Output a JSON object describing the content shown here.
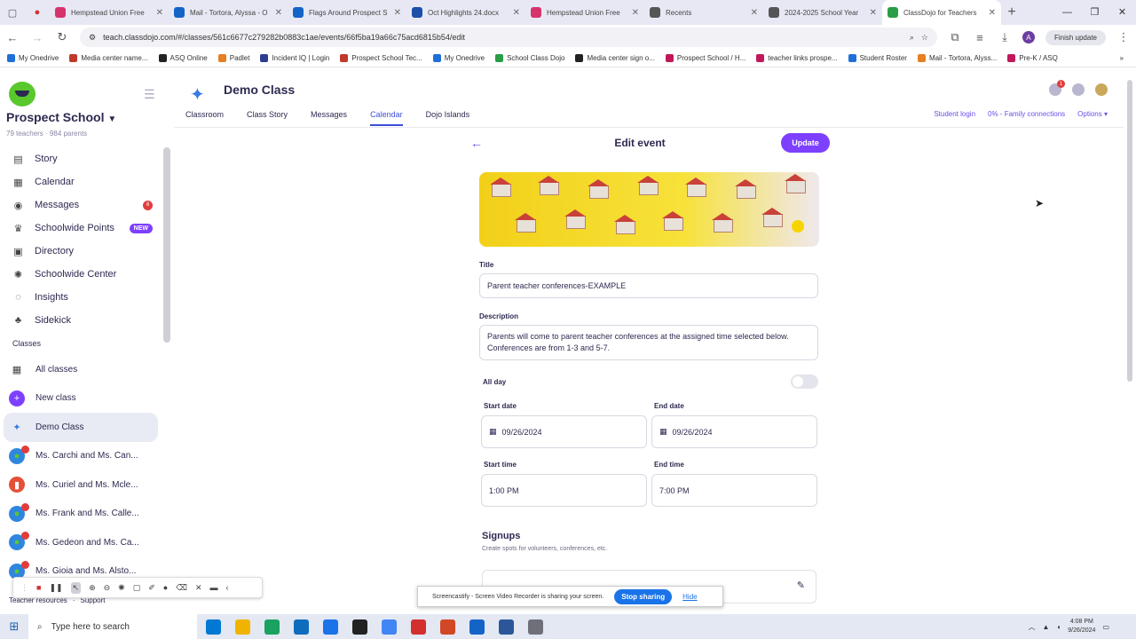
{
  "browser": {
    "tabs": [
      {
        "label": "Hempstead Union Free",
        "color": "#d6336c",
        "active": false
      },
      {
        "label": "Mail - Tortora, Alyssa - O",
        "color": "#1464c8",
        "active": false
      },
      {
        "label": "Flags Around Prospect S",
        "color": "#1464c8",
        "active": false
      },
      {
        "label": "Oct Highlights 24.docx",
        "color": "#1b4fa8",
        "active": false
      },
      {
        "label": "Hempstead Union Free",
        "color": "#d6336c",
        "active": false
      },
      {
        "label": "Recents",
        "color": "#555555",
        "active": false
      },
      {
        "label": "2024-2025 School Year",
        "color": "#555555",
        "active": false
      },
      {
        "label": "ClassDojo for Teachers",
        "color": "#2a9d46",
        "active": true
      }
    ],
    "url": "teach.classdojo.com/#/classes/561c6677c279282b0883c1ae/events/66f5ba19a66c75acd6815b54/edit",
    "finish_update": "Finish update",
    "profile_initial": "A",
    "bookmarks": [
      {
        "label": "My Onedrive",
        "color": "#1e6fd9"
      },
      {
        "label": "Media center name...",
        "color": "#c0392b"
      },
      {
        "label": "ASQ Online",
        "color": "#222222"
      },
      {
        "label": "Padlet",
        "color": "#e67e22"
      },
      {
        "label": "Incident IQ | Login",
        "color": "#2c3e90"
      },
      {
        "label": "Prospect School Tec...",
        "color": "#c0392b"
      },
      {
        "label": "My Onedrive",
        "color": "#1e6fd9"
      },
      {
        "label": "School Class Dojo",
        "color": "#2a9d46"
      },
      {
        "label": "Media center sign o...",
        "color": "#222222"
      },
      {
        "label": "Prospect School / H...",
        "color": "#c2185b"
      },
      {
        "label": "teacher links prospe...",
        "color": "#c2185b"
      },
      {
        "label": "Student Roster",
        "color": "#1e6fd9"
      },
      {
        "label": "Mail - Tortora, Alyss...",
        "color": "#e67e22"
      },
      {
        "label": "Pre-K / ASQ",
        "color": "#c2185b"
      }
    ]
  },
  "sidebar": {
    "school_name": "Prospect School",
    "school_sub": "79 teachers · 984 parents",
    "nav": [
      {
        "label": "Story",
        "icon": "story-icon",
        "glyph": "▤"
      },
      {
        "label": "Calendar",
        "icon": "calendar-icon",
        "glyph": "▦"
      },
      {
        "label": "Messages",
        "icon": "messages-icon",
        "glyph": "◉",
        "badge": "8"
      },
      {
        "label": "Schoolwide Points",
        "icon": "trophy-icon",
        "glyph": "♛",
        "new": "NEW"
      },
      {
        "label": "Directory",
        "icon": "directory-icon",
        "glyph": "▣"
      },
      {
        "label": "Schoolwide Center",
        "icon": "center-icon",
        "glyph": "✺"
      },
      {
        "label": "Insights",
        "icon": "insights-icon",
        "glyph": "◌"
      },
      {
        "label": "Sidekick",
        "icon": "sidekick-icon",
        "glyph": "♣"
      }
    ],
    "classes_heading": "Classes",
    "classes": [
      {
        "label": "All classes",
        "glyph": "▦",
        "color": "#ffffff",
        "fg": "#444444",
        "dot": false
      },
      {
        "label": "New class",
        "glyph": "+",
        "color": "#7d40ff",
        "fg": "#ffffff",
        "dot": false
      },
      {
        "label": "Demo Class",
        "glyph": "✦",
        "color": "#e8eaf4",
        "fg": "#3b7be3",
        "dot": false,
        "selected": true
      },
      {
        "label": "Ms. Carchi and Ms. Can...",
        "glyph": "●",
        "color": "#2e86de",
        "fg": "#58c82c",
        "dot": true
      },
      {
        "label": "Ms. Curiel and Ms. Mcle...",
        "glyph": "▮",
        "color": "#e55039",
        "fg": "#ffffff",
        "dot": false
      },
      {
        "label": "Ms. Frank and Ms. Calle...",
        "glyph": "●",
        "color": "#2e86de",
        "fg": "#58c82c",
        "dot": true
      },
      {
        "label": "Ms. Gedeon and Ms. Ca...",
        "glyph": "●",
        "color": "#2e86de",
        "fg": "#58c82c",
        "dot": true
      },
      {
        "label": "Ms. Gioia and Ms. Alsto...",
        "glyph": "●",
        "color": "#2e86de",
        "fg": "#58c82c",
        "dot": true
      }
    ],
    "footer": [
      "Teacher resources",
      "Support"
    ]
  },
  "header": {
    "class_title": "Demo Class",
    "tabs": [
      "Classroom",
      "Class Story",
      "Messages",
      "Calendar",
      "Dojo Islands"
    ],
    "active_tab": "Calendar",
    "notif_count": "1",
    "student_login": "Student login",
    "family_connections": "0% - Family connections",
    "options": "Options"
  },
  "event": {
    "heading": "Edit event",
    "update_label": "Update",
    "title_label": "Title",
    "title_value": "Parent teacher conferences-EXAMPLE",
    "description_label": "Description",
    "description_value": "Parents will come to parent teacher conferences at the assigned time selected below. Conferences are from 1-3 and 5-7.",
    "all_day_label": "All day",
    "all_day": false,
    "start_date_label": "Start date",
    "start_date": "09/26/2024",
    "end_date_label": "End date",
    "end_date": "09/26/2024",
    "start_time_label": "Start time",
    "start_time": "1:00 PM",
    "end_time_label": "End time",
    "end_time": "7:00 PM",
    "signups_heading": "Signups",
    "signups_sub": "Create spots for volunteers, conferences, etc."
  },
  "overlays": {
    "sharing_text": "Screencastify - Screen Video Recorder is sharing your screen.",
    "stop_sharing": "Stop sharing",
    "hide": "Hide"
  },
  "taskbar": {
    "search_placeholder": "Type here to search",
    "time": "4:08 PM",
    "date": "9/26/2024",
    "app_colors": [
      "#0078d4",
      "#f0b400",
      "#1aa260",
      "#0f6cbd",
      "#1a73e8",
      "#222222",
      "#4285f4",
      "#d32f2f",
      "#d24726",
      "#1464c8",
      "#2b579a",
      "#6f6f7a"
    ]
  }
}
